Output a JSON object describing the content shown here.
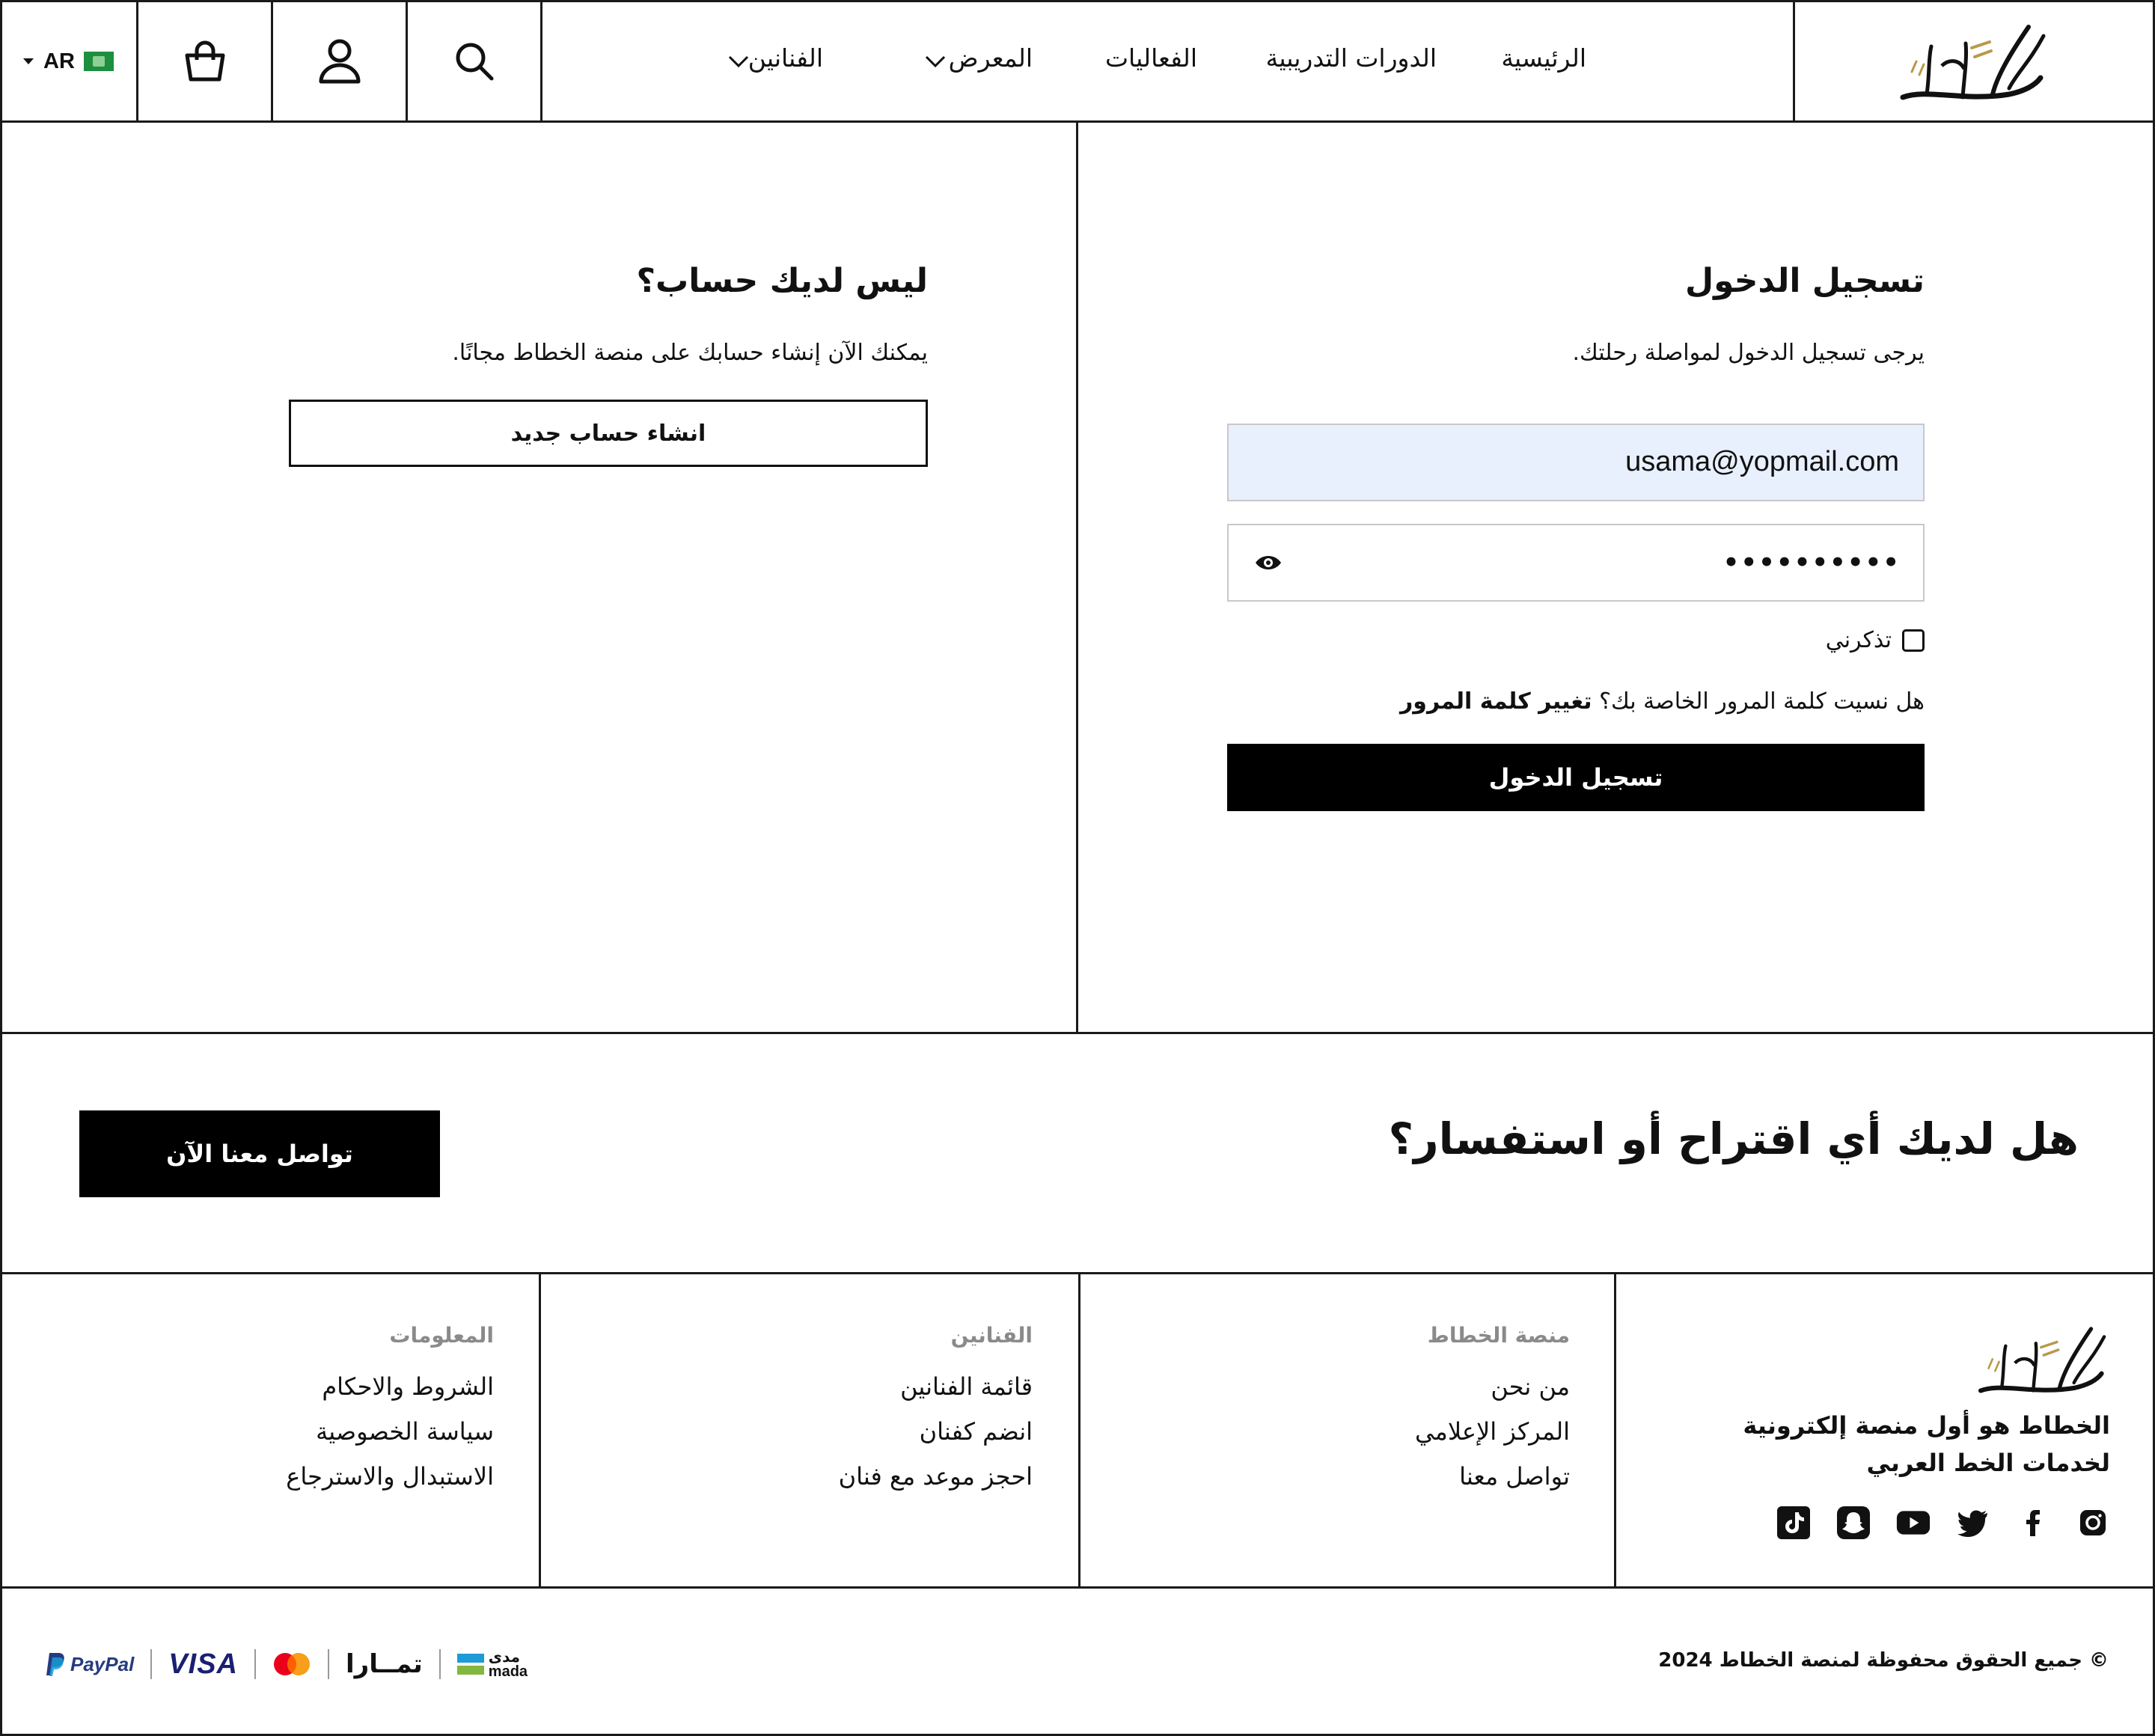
{
  "header": {
    "logo_text": "الخطاط",
    "nav": [
      {
        "label": "الرئيسية"
      },
      {
        "label": "الدورات التدريبية"
      },
      {
        "label": "الفعاليات"
      },
      {
        "label": "المعرض"
      },
      {
        "label": "الفنانين"
      }
    ],
    "lang_label": "AR"
  },
  "login": {
    "title": "تسجيل الدخول",
    "subtitle": "يرجى تسجيل الدخول لمواصلة رحلتك.",
    "email_value": "usama@yopmail.com",
    "password_mask": "••••••••••",
    "remember_label": "تذكرني",
    "forgot_text": "هل نسيت كلمة المرور الخاصة بك؟",
    "forgot_link": "تغيير كلمة المرور",
    "submit_label": "تسجيل الدخول"
  },
  "register": {
    "title": "ليس لديك حساب؟",
    "subtitle": "يمكنك الآن إنشاء حسابك على منصة الخطاط مجانًا.",
    "button_label": "انشاء حساب جديد"
  },
  "cta": {
    "title": "هل لديك أي اقتراح أو استفسار؟",
    "button_label": "تواصل معنا الآن"
  },
  "footer": {
    "about_text": "الخطاط هو أول منصة إلكترونية لخدمات الخط العربي",
    "columns": [
      {
        "heading": "منصة الخطاط",
        "links": [
          "من نحن",
          "المركز الإعلامي",
          "تواصل معنا"
        ]
      },
      {
        "heading": "الفنانين",
        "links": [
          "قائمة الفنانين",
          "انضم كفنان",
          "احجز موعد مع فنان"
        ]
      },
      {
        "heading": "المعلومات",
        "links": [
          "الشروط والاحكام",
          "سياسة الخصوصية",
          "الاستبدال والاسترجاع"
        ]
      }
    ],
    "social_icons": [
      "instagram-icon",
      "facebook-icon",
      "twitter-icon",
      "youtube-icon",
      "snapchat-icon",
      "tiktok-icon"
    ],
    "copyright": "© جميع الحقوق محفوظة لمنصة الخطاط 2024",
    "payments": {
      "mada_ar": "مدى",
      "mada_en": "mada",
      "tamara": "تمــارا",
      "visa": "VISA",
      "paypal": "PayPal"
    }
  },
  "colors": {
    "accent_gold": "#b89a4a",
    "email_field_bg": "#e8f0fe",
    "black": "#000000"
  }
}
